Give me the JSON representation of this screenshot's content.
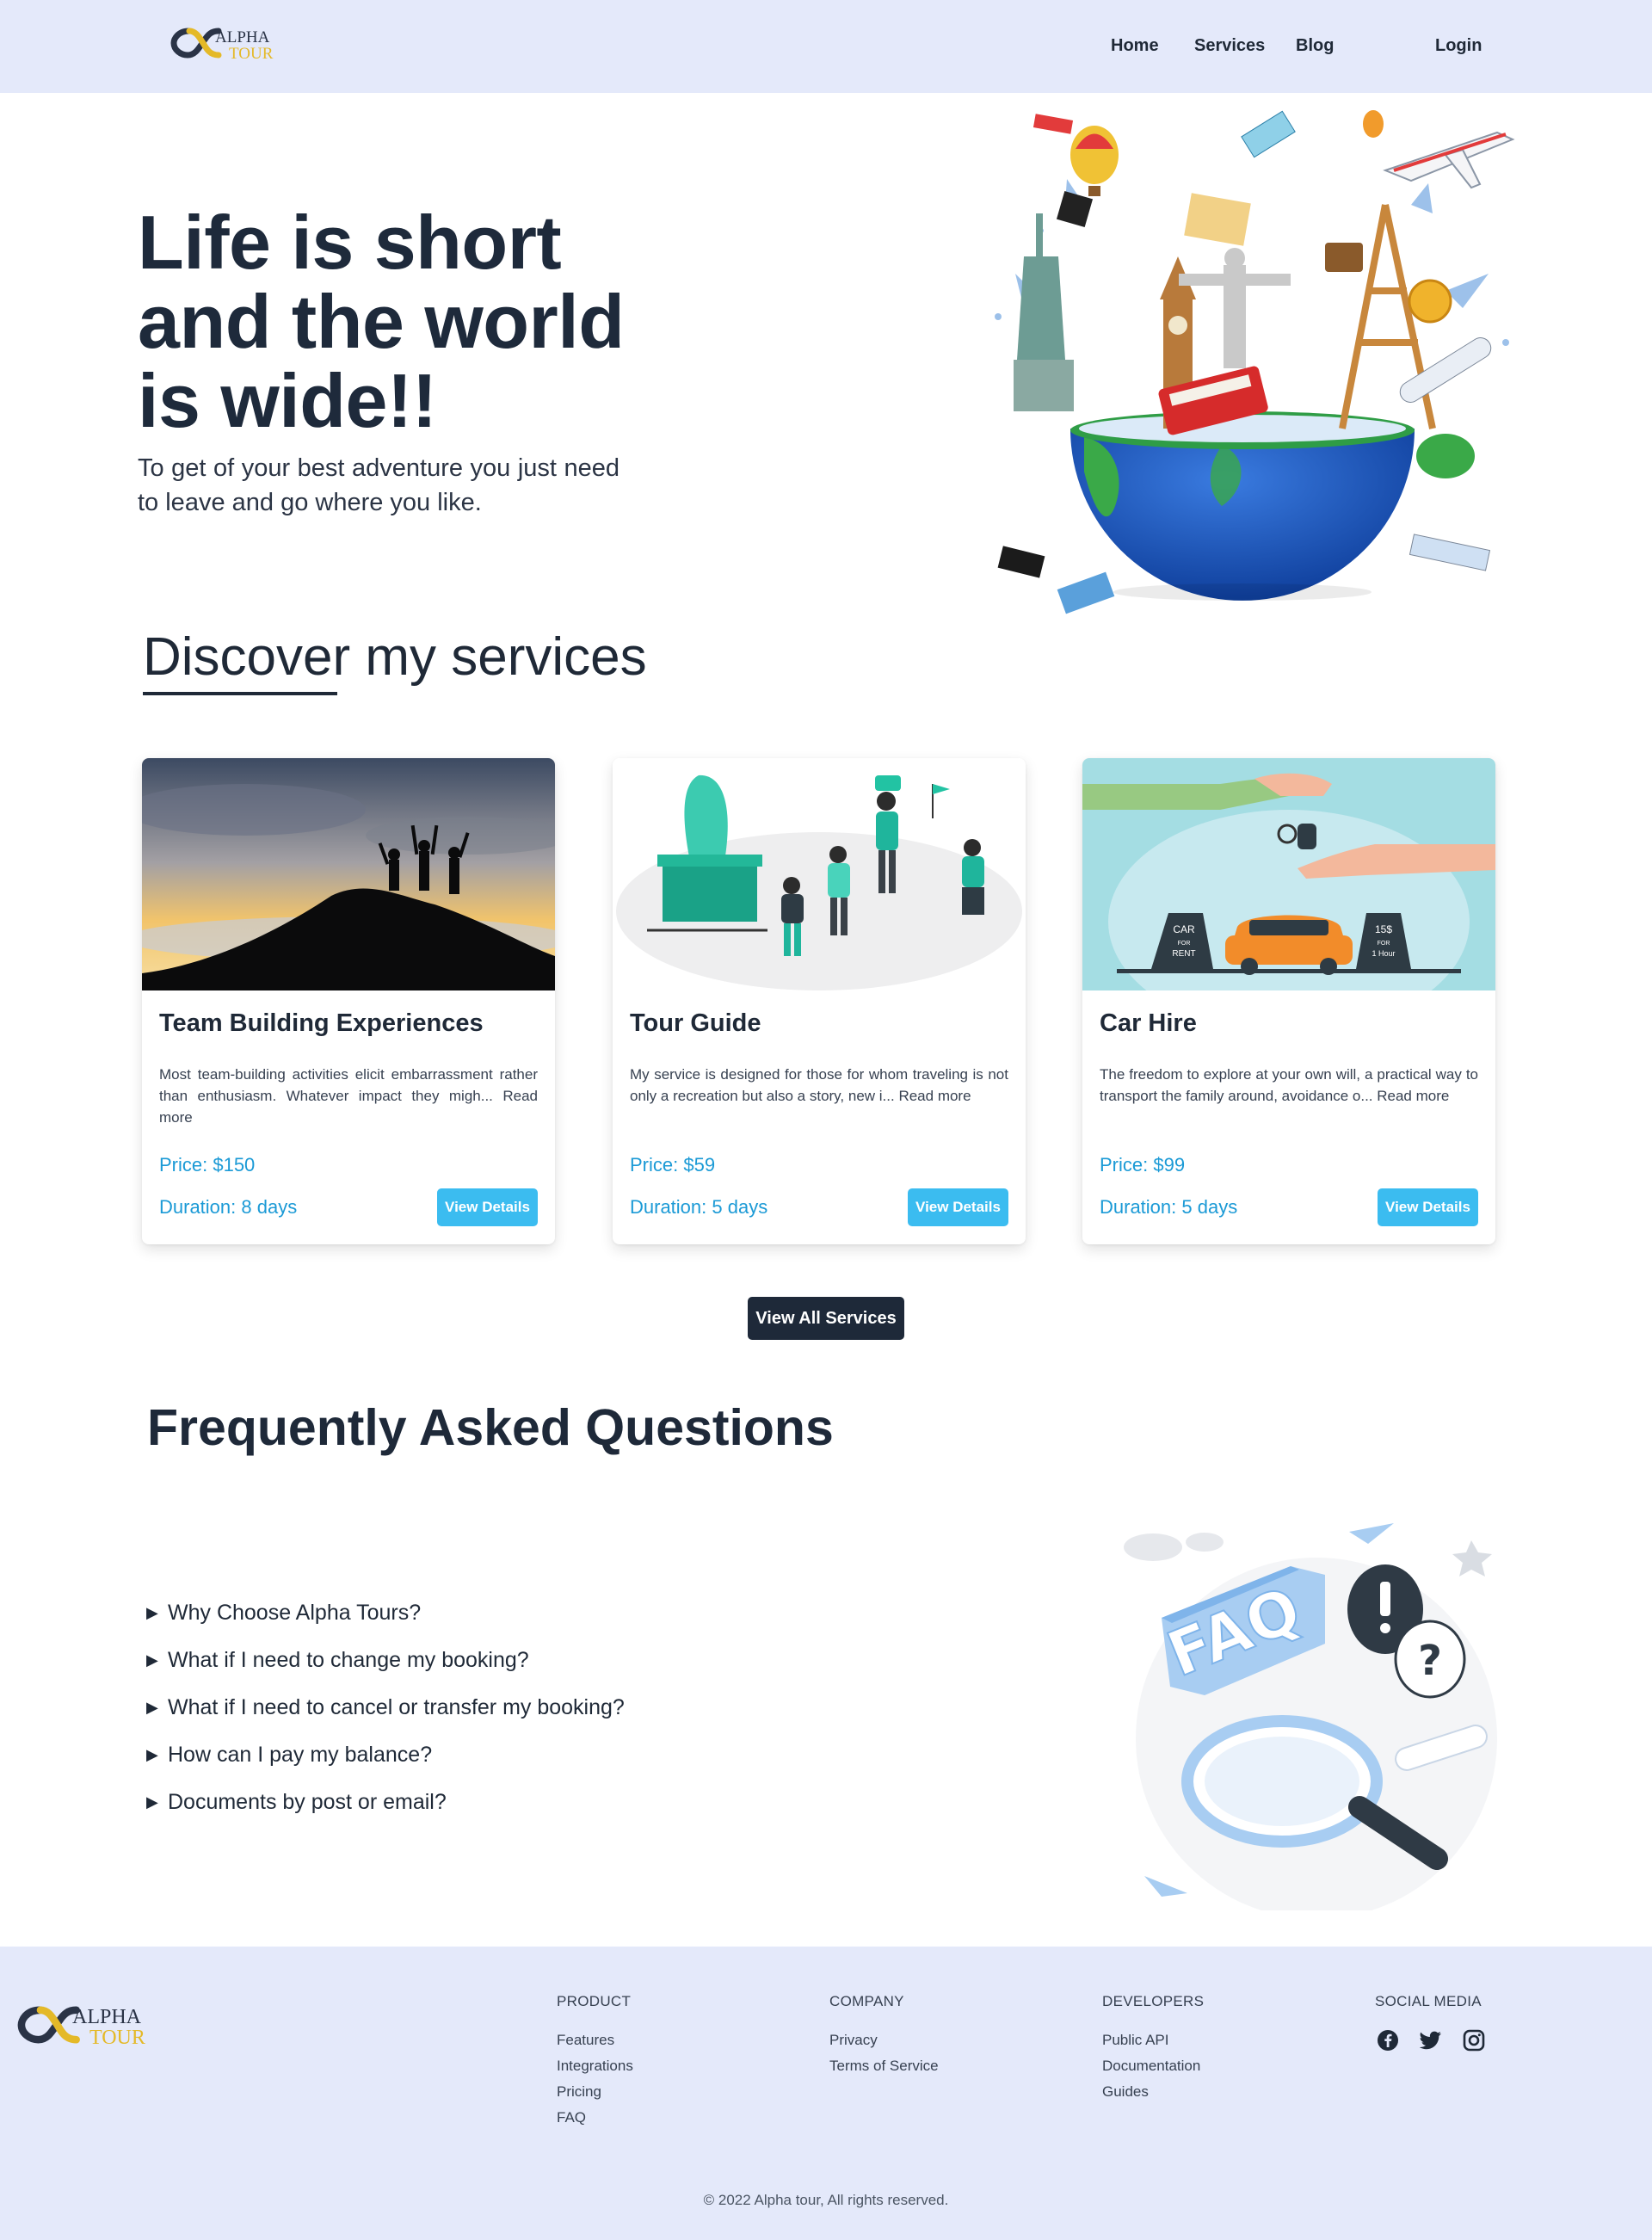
{
  "brand": {
    "line1": "ALPHA",
    "line2": "TOUR",
    "accent": "#e4b928",
    "dark": "#2a3346"
  },
  "nav": {
    "home": "Home",
    "services": "Services",
    "blog": "Blog",
    "login": "Login"
  },
  "hero": {
    "title": "Life is short and the world is wide!!",
    "subtitle": "To get of your best adventure you just need to leave and go where you like."
  },
  "services": {
    "heading": "Discover my services",
    "cards": [
      {
        "title": "Team Building Experiences",
        "description": "Most team-building activities elicit embarrassment rather than enthusiasm. Whatever impact they migh... Read more",
        "price": "Price: $150",
        "duration": "Duration: 8 days",
        "button": "View Details",
        "image": "people-on-mountain-summit-sunset"
      },
      {
        "title": "Tour Guide",
        "description": "My service is designed for those for whom traveling is not only a recreation but also a story, new i... Read more",
        "price": "Price: $59",
        "duration": "Duration: 5 days",
        "button": "View Details",
        "image": "tour-guide-illustration"
      },
      {
        "title": "Car Hire",
        "description": "The freedom to explore at your own will, a practical way to transport the family around, avoidance o... Read more",
        "price": "Price: $99",
        "duration": "Duration: 5 days",
        "button": "View Details",
        "image": "car-rental-illustration",
        "sign_left": [
          "CAR",
          "FOR",
          "RENT"
        ],
        "sign_right": [
          "15$",
          "FOR",
          "1 Hour"
        ]
      }
    ],
    "view_all": "View All Services"
  },
  "faq": {
    "title": "Frequently Asked Questions",
    "art_text": "FAQ",
    "items": [
      "Why Choose Alpha Tours?",
      "What if I need to change my booking?",
      "What if I need to cancel or transfer my booking?",
      "How can I pay my balance?",
      "Documents by post or email?"
    ]
  },
  "footer": {
    "product": {
      "heading": "PRODUCT",
      "links": [
        "Features",
        "Integrations",
        "Pricing",
        "FAQ"
      ]
    },
    "company": {
      "heading": "COMPANY",
      "links": [
        "Privacy",
        "Terms of Service"
      ]
    },
    "developers": {
      "heading": "DEVELOPERS",
      "links": [
        "Public API",
        "Documentation",
        "Guides"
      ]
    },
    "social": {
      "heading": "SOCIAL MEDIA",
      "icons": [
        "facebook-icon",
        "twitter-icon",
        "instagram-icon"
      ]
    },
    "copyright": "© 2022 Alpha tour, All rights reserved."
  },
  "colors": {
    "nav_bg": "#e4e9fa",
    "accent_blue": "#3bbcf0",
    "price_blue": "#1b9ad6",
    "dark": "#1e2939"
  }
}
